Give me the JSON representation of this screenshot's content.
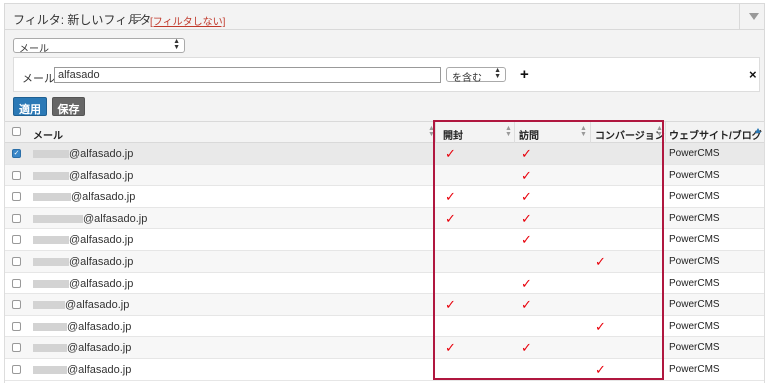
{
  "filter": {
    "title": "フィルタ: 新しいフィルタ",
    "no_filter_link": "[フィルタしない]",
    "field_select": "メール",
    "condition_label": "メール が",
    "condition_value": "alfasado",
    "operator": "を含む",
    "add_symbol": "+",
    "remove_symbol": "×",
    "apply_label": "適用",
    "save_label": "保存"
  },
  "table": {
    "headers": {
      "email": "メール",
      "open": "開封",
      "visit": "訪問",
      "conversion": "コンバージョン",
      "site": "ウェブサイト/ブログ"
    },
    "check_mark": "✓",
    "rows": [
      {
        "email": "@alfasado.jp",
        "selected": true,
        "open": true,
        "visit": true,
        "conversion": false,
        "site": "PowerCMS"
      },
      {
        "email": "@alfasado.jp",
        "selected": false,
        "open": false,
        "visit": true,
        "conversion": false,
        "site": "PowerCMS"
      },
      {
        "email": "@alfasado.jp",
        "selected": false,
        "open": true,
        "visit": true,
        "conversion": false,
        "site": "PowerCMS"
      },
      {
        "email": "@alfasado.jp",
        "selected": false,
        "open": true,
        "visit": true,
        "conversion": false,
        "site": "PowerCMS"
      },
      {
        "email": "@alfasado.jp",
        "selected": false,
        "open": false,
        "visit": true,
        "conversion": false,
        "site": "PowerCMS"
      },
      {
        "email": "@alfasado.jp",
        "selected": false,
        "open": false,
        "visit": false,
        "conversion": true,
        "site": "PowerCMS"
      },
      {
        "email": "@alfasado.jp",
        "selected": false,
        "open": false,
        "visit": true,
        "conversion": false,
        "site": "PowerCMS"
      },
      {
        "email": "@alfasado.jp",
        "selected": false,
        "open": true,
        "visit": true,
        "conversion": false,
        "site": "PowerCMS"
      },
      {
        "email": "@alfasado.jp",
        "selected": false,
        "open": false,
        "visit": false,
        "conversion": true,
        "site": "PowerCMS"
      },
      {
        "email": "@alfasado.jp",
        "selected": false,
        "open": true,
        "visit": true,
        "conversion": false,
        "site": "PowerCMS"
      },
      {
        "email": "@alfasado.jp",
        "selected": false,
        "open": false,
        "visit": false,
        "conversion": true,
        "site": "PowerCMS"
      }
    ]
  },
  "colors": {
    "accent": "#2b79b6",
    "check": "#e8000b",
    "highlight": "#b0173f"
  }
}
